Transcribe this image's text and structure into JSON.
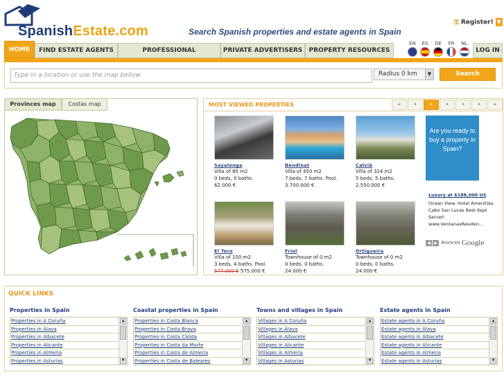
{
  "brand": {
    "logo_part1": "Spanish",
    "logo_part2": "Estate.com",
    "tagline": "Search Spanish properties and estate agents in Spain"
  },
  "header": {
    "register_label": "Register!",
    "register_icon": "key-icon"
  },
  "nav": {
    "items": [
      {
        "label": "HOME",
        "active": true
      },
      {
        "label": "FIND ESTATE AGENTS"
      },
      {
        "label": "PROFESSIONAL ADVERTISERS"
      },
      {
        "label": "PRIVATE ADVERTISERS"
      },
      {
        "label": "PROPERTY RESOURCES"
      },
      {
        "label": "LOG IN"
      }
    ],
    "languages": [
      {
        "code": "EN",
        "flag": "uk-flag-icon"
      },
      {
        "code": "ES",
        "flag": "spain-flag-icon"
      },
      {
        "code": "DE",
        "flag": "germany-flag-icon"
      },
      {
        "code": "FR",
        "flag": "france-flag-icon"
      },
      {
        "code": "NL",
        "flag": "netherlands-flag-icon"
      }
    ]
  },
  "search": {
    "placeholder": "Type in a location or use the map bellow",
    "radius_value": "Radius 0 km",
    "button_label": "Search"
  },
  "map": {
    "tabs": [
      "Provinces map",
      "Costas map"
    ],
    "active_tab": 0
  },
  "most_viewed": {
    "title": "MOST VIEWED PROPERTIES",
    "pager": [
      "«",
      "•",
      "•",
      "•",
      "•",
      "•",
      "»"
    ],
    "pager_active": 2,
    "properties": [
      {
        "name": "Sayalonga",
        "type": "Villa of 85 m2",
        "beds": "0 beds, 0 baths.",
        "price": "62.000 €",
        "old_price": ""
      },
      {
        "name": "Bendinat",
        "type": "Villa of 450 m2",
        "beds": "7 beds, 7 baths. Pool.",
        "price": "3.700.000 €",
        "old_price": ""
      },
      {
        "name": "Calvià",
        "type": "Villa of 324 m2",
        "beds": "5 beds, 5 baths.",
        "price": "2.550.000 €",
        "old_price": ""
      },
      {
        "name": "El Toro",
        "type": "Villa of 150 m2",
        "beds": "3 beds, 4 baths. Pool.",
        "price": "575.000 €",
        "old_price": "577.000 €"
      },
      {
        "name": "Friol",
        "type": "Townhouse of 0 m2",
        "beds": "0 beds, 0 baths.",
        "price": "24.000 €",
        "old_price": ""
      },
      {
        "name": "Ortigueira",
        "type": "Townhouse of 0 m2",
        "beds": "0 beds, 0 baths.",
        "price": "24.000 €",
        "old_price": ""
      }
    ]
  },
  "ad": {
    "banner_text": "Are you ready to buy a property in Spain?",
    "link": "Luxury at $188,000 US",
    "text": "Ocean View. Hotel Amenities. Cabo San Lucas Best Kept Secret! www.VentanasResiden...",
    "by_label": "Anuncios",
    "google": "Google"
  },
  "quick_links": {
    "title": "QUICK LINKS",
    "columns": [
      {
        "heading": "Properties in Spain",
        "links": [
          "Properties in A Coruña",
          "Properties in Álava",
          "Properties in Albacete",
          "Properties in Alicante",
          "Properties in Almeria",
          "Properties in Asturias"
        ]
      },
      {
        "heading": "Coastal properties in Spain",
        "links": [
          "Properties in Costa Blanca",
          "Properties in Costa Brava",
          "Properties in Costa Cálida",
          "Properties in Costa da Morte",
          "Properties in Costa de Almería",
          "Properties in Costa de Baleares"
        ]
      },
      {
        "heading": "Towns and villages in Spain",
        "links": [
          "Villages in A Coruña",
          "Villages in Álava",
          "Villages in Albacete",
          "Villages in Alicante",
          "Villages in Almeria",
          "Villages in Asturias"
        ]
      },
      {
        "heading": "Estate agents in Spain",
        "links": [
          "Estate agents in A Coruña",
          "Estate agents in Álava",
          "Estate agents in Albacete",
          "Estate agents in Alicante",
          "Estate agents in Almeria",
          "Estate agents in Asturias"
        ]
      }
    ]
  },
  "colors": {
    "accent": "#f2a51a",
    "brand_blue": "#1f3c78",
    "map_green": "#6e9a4c"
  }
}
